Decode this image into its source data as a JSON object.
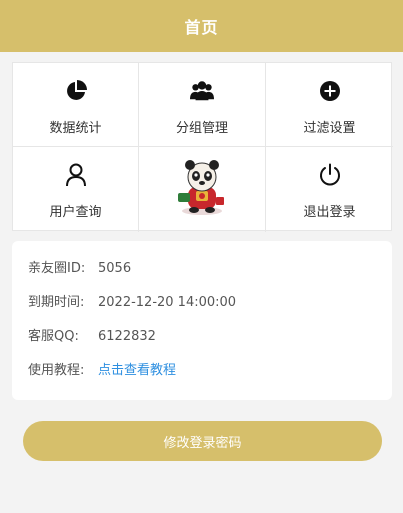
{
  "header": {
    "title": "首页"
  },
  "menu": [
    {
      "label": "数据统计",
      "icon": "pie-chart-icon"
    },
    {
      "label": "分组管理",
      "icon": "group-icon"
    },
    {
      "label": "过滤设置",
      "icon": "add-circle-icon"
    },
    {
      "label": "用户查询",
      "icon": "user-icon"
    },
    {
      "label": "",
      "icon": "mascot-image"
    },
    {
      "label": "退出登录",
      "icon": "power-icon"
    }
  ],
  "info": {
    "circle_id_label": "亲友圈ID:",
    "circle_id_value": "5056",
    "expiry_label": "到期时间:",
    "expiry_value": "2022-12-20 14:00:00",
    "qq_label": "客服QQ:",
    "qq_value": "6122832",
    "tutorial_label": "使用教程:",
    "tutorial_link": "点击查看教程"
  },
  "actions": {
    "change_password": "修改登录密码"
  },
  "colors": {
    "accent": "#d6bf6b",
    "link": "#2e8fe0"
  }
}
